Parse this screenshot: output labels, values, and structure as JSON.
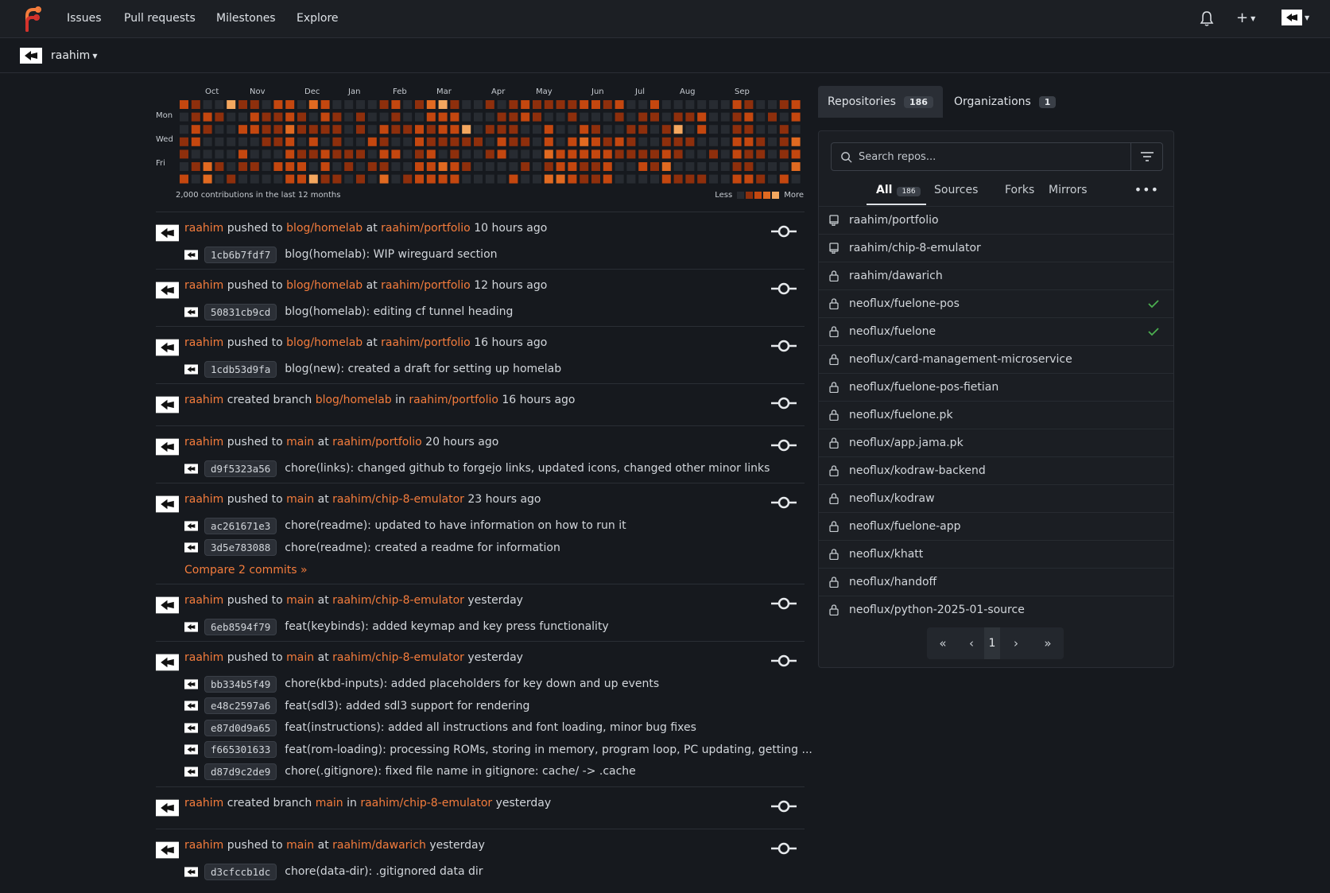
{
  "nav": {
    "items": [
      "Issues",
      "Pull requests",
      "Milestones",
      "Explore"
    ],
    "icons": {
      "logo": "forgejo-logo",
      "bell": "bell-icon",
      "plus": "plus-icon",
      "user": "avatar"
    }
  },
  "context": {
    "user": "raahim"
  },
  "heatmap": {
    "months": [
      "Oct",
      "Nov",
      "Dec",
      "Jan",
      "Feb",
      "Mar",
      "Apr",
      "May",
      "Jun",
      "Jul",
      "Aug",
      "Sep"
    ],
    "days": [
      "Mon",
      "Wed",
      "Fri"
    ],
    "summary": "2,000 contributions in the last 12 months",
    "legend_less": "Less",
    "legend_more": "More",
    "colors": [
      "#272b31",
      "#8e2f0c",
      "#c4470f",
      "#e16a21",
      "#f4a75f"
    ]
  },
  "feed": [
    {
      "user": "raahim",
      "action": "pushed to",
      "ref": "blog/homelab",
      "prep": "at",
      "repo": "raahim/portfolio",
      "time": "10 hours ago",
      "commits": [
        {
          "sha": "1cb6b7fdf7",
          "msg": "blog(homelab): WIP wireguard section"
        }
      ]
    },
    {
      "user": "raahim",
      "action": "pushed to",
      "ref": "blog/homelab",
      "prep": "at",
      "repo": "raahim/portfolio",
      "time": "12 hours ago",
      "commits": [
        {
          "sha": "50831cb9cd",
          "msg": "blog(homelab): editing cf tunnel heading"
        }
      ]
    },
    {
      "user": "raahim",
      "action": "pushed to",
      "ref": "blog/homelab",
      "prep": "at",
      "repo": "raahim/portfolio",
      "time": "16 hours ago",
      "commits": [
        {
          "sha": "1cdb53d9fa",
          "msg": "blog(new): created a draft for setting up homelab"
        }
      ]
    },
    {
      "user": "raahim",
      "action": "created branch",
      "ref": "blog/homelab",
      "prep": "in",
      "repo": "raahim/portfolio",
      "time": "16 hours ago",
      "commits": []
    },
    {
      "user": "raahim",
      "action": "pushed to",
      "ref": "main",
      "prep": "at",
      "repo": "raahim/portfolio",
      "time": "20 hours ago",
      "commits": [
        {
          "sha": "d9f5323a56",
          "msg": "chore(links): changed github to forgejo links, updated icons, changed other minor links"
        }
      ]
    },
    {
      "user": "raahim",
      "action": "pushed to",
      "ref": "main",
      "prep": "at",
      "repo": "raahim/chip-8-emulator",
      "time": "23 hours ago",
      "commits": [
        {
          "sha": "ac261671e3",
          "msg": "chore(readme): updated to have information on how to run it"
        },
        {
          "sha": "3d5e783088",
          "msg": "chore(readme): created a readme for information"
        }
      ],
      "compare": "Compare 2 commits »"
    },
    {
      "user": "raahim",
      "action": "pushed to",
      "ref": "main",
      "prep": "at",
      "repo": "raahim/chip-8-emulator",
      "time": "yesterday",
      "commits": [
        {
          "sha": "6eb8594f79",
          "msg": "feat(keybinds): added keymap and key press functionality"
        }
      ]
    },
    {
      "user": "raahim",
      "action": "pushed to",
      "ref": "main",
      "prep": "at",
      "repo": "raahim/chip-8-emulator",
      "time": "yesterday",
      "commits": [
        {
          "sha": "bb334b5f49",
          "msg": "chore(kbd-inputs): added placeholders for key down and up events"
        },
        {
          "sha": "e48c2597a6",
          "msg": "feat(sdl3): added sdl3 support for rendering"
        },
        {
          "sha": "e87d0d9a65",
          "msg": "feat(instructions): added all instructions and font loading, minor bug fixes"
        },
        {
          "sha": "f665301633",
          "msg": "feat(rom-loading): processing ROMs, storing in memory, program loop, PC updating, getting ..."
        },
        {
          "sha": "d87d9c2de9",
          "msg": "chore(.gitignore): fixed file name in gitignore: cache/ -> .cache"
        }
      ]
    },
    {
      "user": "raahim",
      "action": "created branch",
      "ref": "main",
      "prep": "in",
      "repo": "raahim/chip-8-emulator",
      "time": "yesterday",
      "commits": []
    },
    {
      "user": "raahim",
      "action": "pushed to",
      "ref": "main",
      "prep": "at",
      "repo": "raahim/dawarich",
      "time": "yesterday",
      "commits": [
        {
          "sha": "d3cfccb1dc",
          "msg": "chore(data-dir): .gitignored data dir"
        }
      ]
    }
  ],
  "right": {
    "tabs": [
      {
        "label": "Repositories",
        "count": "186"
      },
      {
        "label": "Organizations",
        "count": "1"
      }
    ],
    "search_placeholder": "Search repos...",
    "subtabs": {
      "all": "All",
      "all_count": "186",
      "sources": "Sources",
      "forks": "Forks",
      "mirrors": "Mirrors"
    },
    "repos": [
      {
        "name": "raahim/portfolio",
        "icon": "repo-icon",
        "check": false
      },
      {
        "name": "raahim/chip-8-emulator",
        "icon": "repo-icon",
        "check": false
      },
      {
        "name": "raahim/dawarich",
        "icon": "lock-icon",
        "check": false
      },
      {
        "name": "neoflux/fuelone-pos",
        "icon": "lock-icon",
        "check": true
      },
      {
        "name": "neoflux/fuelone",
        "icon": "lock-icon",
        "check": true
      },
      {
        "name": "neoflux/card-management-microservice",
        "icon": "lock-icon",
        "check": false
      },
      {
        "name": "neoflux/fuelone-pos-fietian",
        "icon": "lock-icon",
        "check": false
      },
      {
        "name": "neoflux/fuelone.pk",
        "icon": "lock-icon",
        "check": false
      },
      {
        "name": "neoflux/app.jama.pk",
        "icon": "lock-icon",
        "check": false
      },
      {
        "name": "neoflux/kodraw-backend",
        "icon": "lock-icon",
        "check": false
      },
      {
        "name": "neoflux/kodraw",
        "icon": "lock-icon",
        "check": false
      },
      {
        "name": "neoflux/fuelone-app",
        "icon": "lock-icon",
        "check": false
      },
      {
        "name": "neoflux/khatt",
        "icon": "lock-icon",
        "check": false
      },
      {
        "name": "neoflux/handoff",
        "icon": "lock-icon",
        "check": false
      },
      {
        "name": "neoflux/python-2025-01-source",
        "icon": "lock-icon",
        "check": false
      }
    ],
    "pager": {
      "first": "«",
      "prev": "‹",
      "current": "1",
      "next": "›",
      "last": "»"
    },
    "colors": {
      "accent": "#f47c3c",
      "check": "#4caf50"
    }
  }
}
